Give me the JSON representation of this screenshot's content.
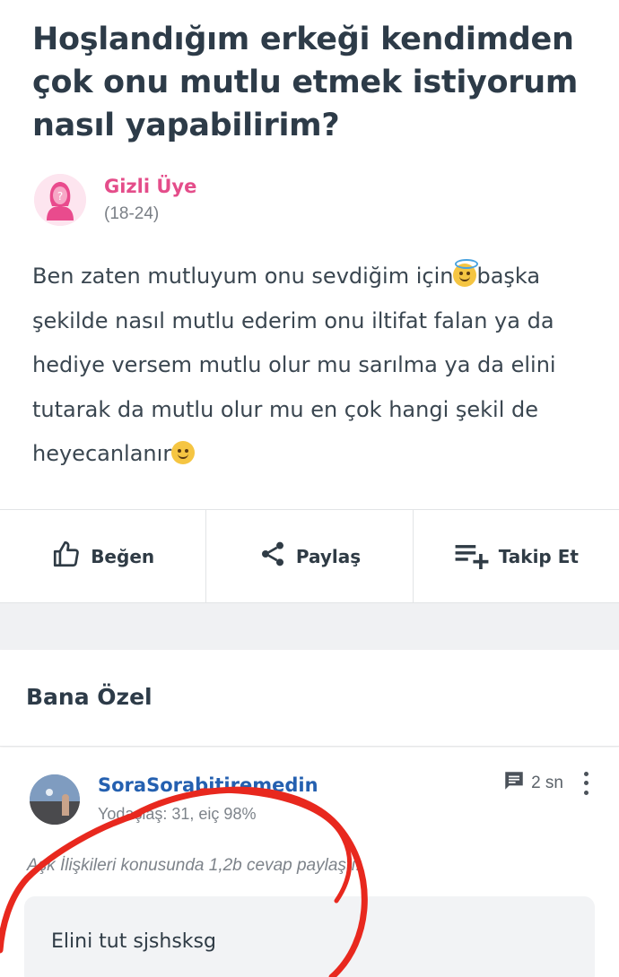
{
  "question": {
    "title": "Hoşlandığım erkeği kendimden çok onu mutlu etmek istiyorum nasıl yapabilirim?",
    "author": {
      "name": "Gizli Üye",
      "age": "(18-24)",
      "avatar_icon": "anonymous-female-icon"
    },
    "body": {
      "part1": "Ben zaten mutluyum onu sevdiğim için",
      "part2": "başka şekilde nasıl mutlu ederim onu iltifat falan ya da hediye versem mutlu olur mu sarılma ya da elini tutarak da mutlu olur mu en çok hangi şekil de heyecanlanır"
    }
  },
  "actions": {
    "like": {
      "label": "Beğen",
      "icon": "thumbs-up-icon"
    },
    "share": {
      "label": "Paylaş",
      "icon": "share-icon"
    },
    "follow": {
      "label": "Takip Et",
      "icon": "playlist-add-icon"
    }
  },
  "section": {
    "title": "Bana Özel"
  },
  "answer": {
    "username": "SoraSorabitiremedin",
    "meta": "Yodaşlaş: 31, eiç 98%",
    "time": "2 sn",
    "topic": "Aşk İlişkileri konusunda 1,2b cevap paylaştı.",
    "text": "Elini tut sjshsksg"
  },
  "colors": {
    "author_pink": "#e44d8a",
    "username_blue": "#2460b0",
    "scribble_red": "#e8281e"
  }
}
